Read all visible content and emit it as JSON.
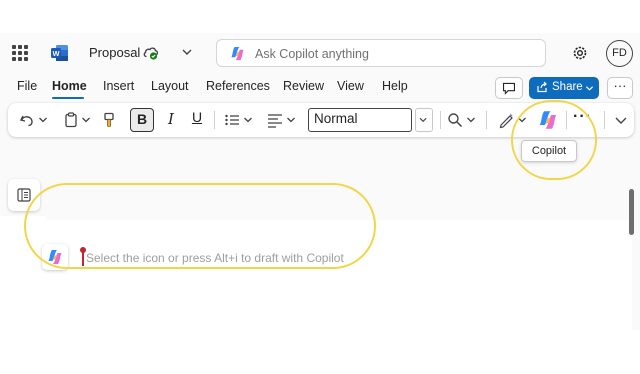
{
  "titlebar": {
    "doc_title": "Proposal",
    "search_placeholder": "Ask Copilot anything",
    "avatar_initials": "FD"
  },
  "menu": {
    "tabs": [
      "File",
      "Home",
      "Insert",
      "Layout",
      "References",
      "Review",
      "View",
      "Help"
    ],
    "active_tab": "Home",
    "share_label": "Share",
    "more_label": "···"
  },
  "ribbon": {
    "bold": "B",
    "italic": "I",
    "underline": "U",
    "style_value": "Normal",
    "more_label": "···",
    "copilot_tooltip": "Copilot"
  },
  "document": {
    "draft_hint": "Select the icon or press Alt+i to draft with Copilot"
  },
  "colors": {
    "accent": "#0f6cbd",
    "highlight": "#f1d64a",
    "cursor": "#c4262e"
  },
  "icons": [
    "app-launcher-icon",
    "word-logo-icon",
    "cloud-saved-icon",
    "copilot-icon",
    "gear-icon",
    "comment-icon",
    "share-icon",
    "undo-icon",
    "clipboard-icon",
    "format-painter-icon",
    "bullets-icon",
    "align-icon",
    "search-icon",
    "editor-pen-icon",
    "nav-pane-icon"
  ]
}
